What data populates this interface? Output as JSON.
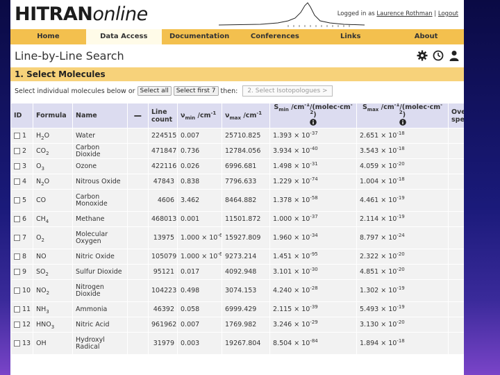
{
  "header": {
    "logo_bold": "HITRAN",
    "logo_light": "online",
    "logged_in_prefix": "Logged in as ",
    "user": "Laurence Rothman",
    "separator": " | ",
    "logout": "Logout"
  },
  "nav": {
    "home": "Home",
    "data_access": "Data Access",
    "documentation": "Documentation",
    "conferences": "Conferences",
    "links": "Links",
    "about": "About"
  },
  "page_title": "Line-by-Line Search",
  "section_title": "1. Select Molecules",
  "select_row": {
    "prefix": "Select individual molecules below or",
    "select_all": "Select all",
    "select_first": "Select first 7",
    "then": "then:",
    "next_step": "2. Select Isotopologues >"
  },
  "table": {
    "headers": {
      "id": "ID",
      "formula": "Formula",
      "name": "Name",
      "minus": "−",
      "line_count_1": "Line",
      "line_count_2": "count",
      "vmin": "ν",
      "vmin_sub": "min",
      "vmin_unit": " /cm",
      "vmin_sup": "-1",
      "vmax": "ν",
      "vmax_sub": "max",
      "vmax_unit": " /cm",
      "vmax_sup": "-1",
      "smin": "S",
      "smin_sub": "min",
      "smin_unit": " /cm",
      "smin_sup": "-1",
      "smin_rest": "/(molec·cm",
      "smin_sup2": "-2",
      "smin_close": ")",
      "smax": "S",
      "smax_sub": "max",
      "smax_unit": " /cm",
      "smax_sup": "-1",
      "smax_rest": "/(molec·cm",
      "smax_sup2": "-2",
      "smax_close": ")",
      "overview_1": "Overview",
      "overview_2": "spectrum"
    },
    "rows": [
      {
        "id": "1",
        "f_main": "H",
        "f_sub": "2",
        "f_tail": "O",
        "f_sub2": "",
        "name": "Water",
        "count": "224515",
        "vmin": "0.007",
        "vmin_exp": "",
        "vmax": "25710.825",
        "smin": "1.393 × 10",
        "smin_exp": "-37",
        "smax": "2.651 × 10",
        "smax_exp": "-18"
      },
      {
        "id": "2",
        "f_main": "CO",
        "f_sub": "2",
        "f_tail": "",
        "f_sub2": "",
        "name": "Carbon Dioxide",
        "count": "471847",
        "vmin": "0.736",
        "vmin_exp": "",
        "vmax": "12784.056",
        "smin": "3.934 × 10",
        "smin_exp": "-40",
        "smax": "3.543 × 10",
        "smax_exp": "-18"
      },
      {
        "id": "3",
        "f_main": "O",
        "f_sub": "3",
        "f_tail": "",
        "f_sub2": "",
        "name": "Ozone",
        "count": "422116",
        "vmin": "0.026",
        "vmin_exp": "",
        "vmax": "6996.681",
        "smin": "1.498 × 10",
        "smin_exp": "-31",
        "smax": "4.059 × 10",
        "smax_exp": "-20"
      },
      {
        "id": "4",
        "f_main": "N",
        "f_sub": "2",
        "f_tail": "O",
        "f_sub2": "",
        "name": "Nitrous Oxide",
        "count": "47843",
        "vmin": "0.838",
        "vmin_exp": "",
        "vmax": "7796.633",
        "smin": "1.229 × 10",
        "smin_exp": "-74",
        "smax": "1.004 × 10",
        "smax_exp": "-18"
      },
      {
        "id": "5",
        "f_main": "CO",
        "f_sub": "",
        "f_tail": "",
        "f_sub2": "",
        "name": "Carbon Monoxide",
        "count": "4606",
        "vmin": "3.462",
        "vmin_exp": "",
        "vmax": "8464.882",
        "smin": "1.378 × 10",
        "smin_exp": "-58",
        "smax": "4.461 × 10",
        "smax_exp": "-19"
      },
      {
        "id": "6",
        "f_main": "CH",
        "f_sub": "4",
        "f_tail": "",
        "f_sub2": "",
        "name": "Methane",
        "count": "468013",
        "vmin": "0.001",
        "vmin_exp": "",
        "vmax": "11501.872",
        "smin": "1.000 × 10",
        "smin_exp": "-37",
        "smax": "2.114 × 10",
        "smax_exp": "-19"
      },
      {
        "id": "7",
        "f_main": "O",
        "f_sub": "2",
        "f_tail": "",
        "f_sub2": "",
        "name": "Molecular Oxygen",
        "count": "13975",
        "vmin": "1.000 × 10",
        "vmin_exp": "-6",
        "vmax": "15927.809",
        "smin": "1.960 × 10",
        "smin_exp": "-34",
        "smax": "8.797 × 10",
        "smax_exp": "-24"
      },
      {
        "id": "8",
        "f_main": "NO",
        "f_sub": "",
        "f_tail": "",
        "f_sub2": "",
        "name": "Nitric Oxide",
        "count": "105079",
        "vmin": "1.000 × 10",
        "vmin_exp": "-6",
        "vmax": "9273.214",
        "smin": "1.451 × 10",
        "smin_exp": "-95",
        "smax": "2.322 × 10",
        "smax_exp": "-20"
      },
      {
        "id": "9",
        "f_main": "SO",
        "f_sub": "2",
        "f_tail": "",
        "f_sub2": "",
        "name": "Sulfur Dioxide",
        "count": "95121",
        "vmin": "0.017",
        "vmin_exp": "",
        "vmax": "4092.948",
        "smin": "3.101 × 10",
        "smin_exp": "-30",
        "smax": "4.851 × 10",
        "smax_exp": "-20"
      },
      {
        "id": "10",
        "f_main": "NO",
        "f_sub": "2",
        "f_tail": "",
        "f_sub2": "",
        "name": "Nitrogen Dioxide",
        "count": "104223",
        "vmin": "0.498",
        "vmin_exp": "",
        "vmax": "3074.153",
        "smin": "4.240 × 10",
        "smin_exp": "-28",
        "smax": "1.302 × 10",
        "smax_exp": "-19"
      },
      {
        "id": "11",
        "f_main": "NH",
        "f_sub": "3",
        "f_tail": "",
        "f_sub2": "",
        "name": "Ammonia",
        "count": "46392",
        "vmin": "0.058",
        "vmin_exp": "",
        "vmax": "6999.429",
        "smin": "2.115 × 10",
        "smin_exp": "-39",
        "smax": "5.493 × 10",
        "smax_exp": "-19"
      },
      {
        "id": "12",
        "f_main": "HNO",
        "f_sub": "3",
        "f_tail": "",
        "f_sub2": "",
        "name": "Nitric Acid",
        "count": "961962",
        "vmin": "0.007",
        "vmin_exp": "",
        "vmax": "1769.982",
        "smin": "3.246 × 10",
        "smin_exp": "-29",
        "smax": "3.130 × 10",
        "smax_exp": "-20"
      },
      {
        "id": "13",
        "f_main": "OH",
        "f_sub": "",
        "f_tail": "",
        "f_sub2": "",
        "name": "Hydroxyl Radical",
        "count": "31979",
        "vmin": "0.003",
        "vmin_exp": "",
        "vmax": "19267.804",
        "smin": "8.504 × 10",
        "smin_exp": "-84",
        "smax": "1.894 × 10",
        "smax_exp": "-18"
      }
    ]
  },
  "icons": [
    "gear-icon",
    "clock-icon",
    "user-icon",
    "info-icon",
    "spectrum-icon",
    "checkbox"
  ],
  "colors": {
    "nav_bg": "#f3c04e",
    "section_bg": "#f7d27a",
    "header_row_bg": "#dcdcf0",
    "row_bg": "#f2f2f2"
  }
}
